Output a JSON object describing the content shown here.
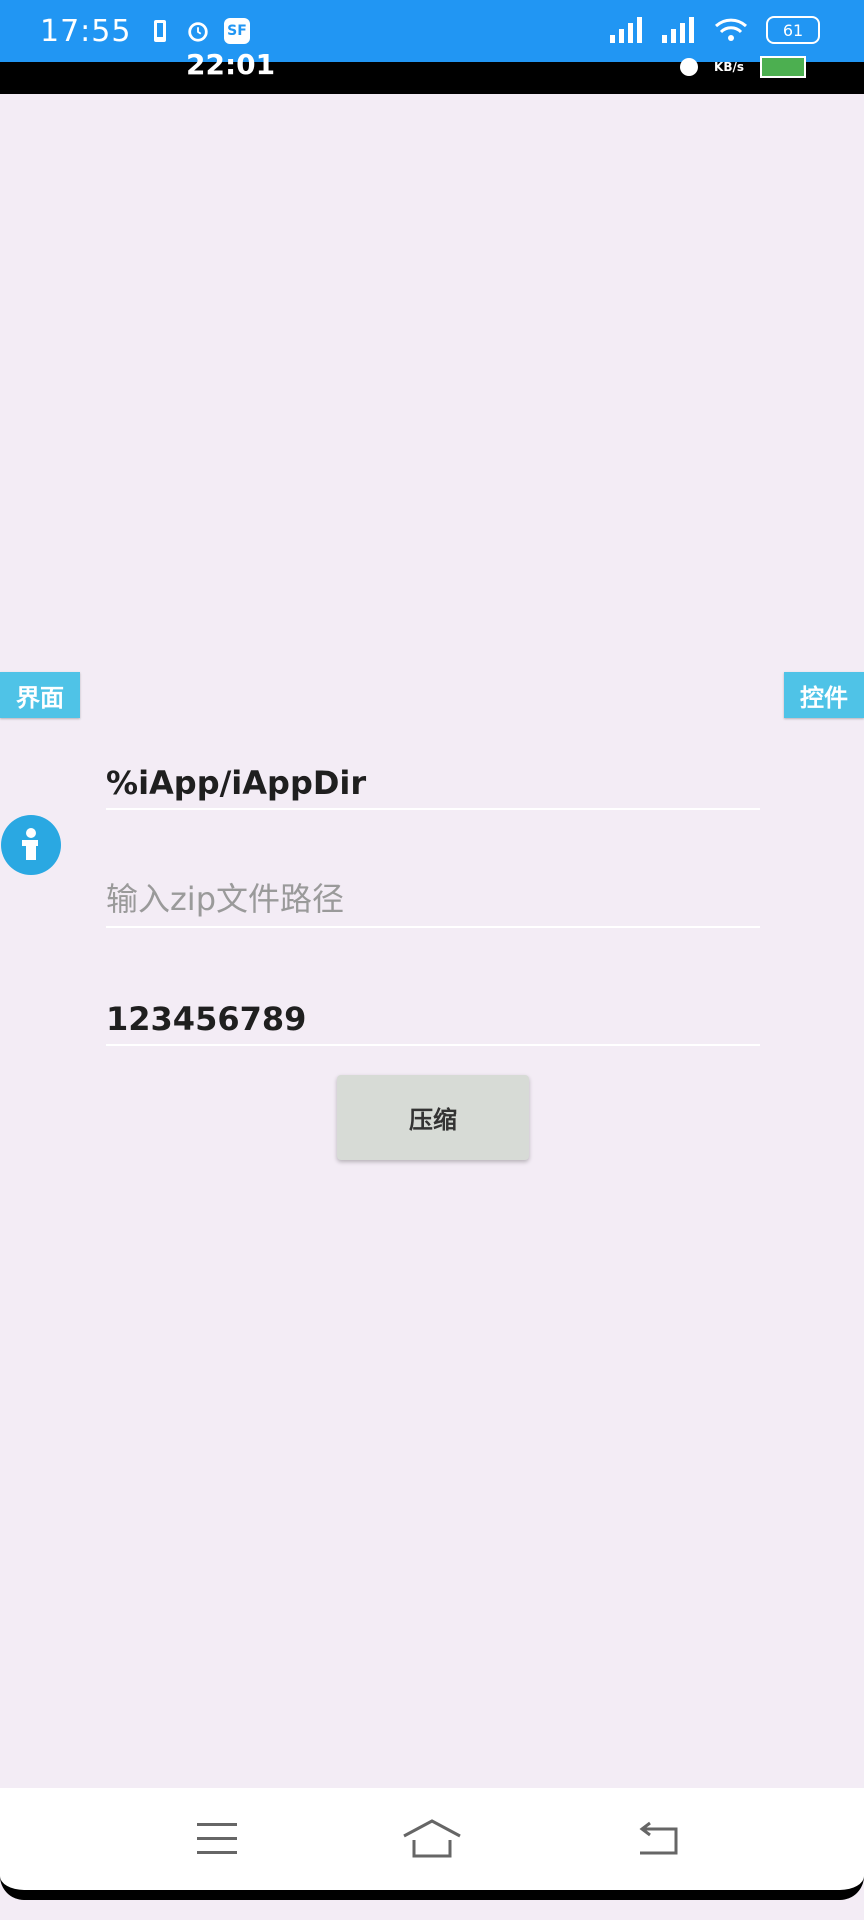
{
  "status_bar": {
    "time": "17:55",
    "battery": "61",
    "sf_badge": "SF",
    "colors": {
      "bar": "#2196f3"
    }
  },
  "inner_status": {
    "time": "22:01",
    "kb_label": "KB/s",
    "battery": "98"
  },
  "side_tabs": {
    "left_label": "界面",
    "right_label": "控件"
  },
  "form": {
    "path_value": "%iApp/iAppDir",
    "zip_placeholder": "输入zip文件路径",
    "password_value": "123456789",
    "compress_label": "压缩"
  },
  "colors": {
    "background": "#f3ecf5",
    "tab": "#4fc3e7",
    "info": "#2aa8e2",
    "button": "#d7dbd6"
  },
  "icons": {
    "info": "info-icon",
    "menu": "menu-icon",
    "home": "home-icon",
    "back": "back-icon"
  }
}
